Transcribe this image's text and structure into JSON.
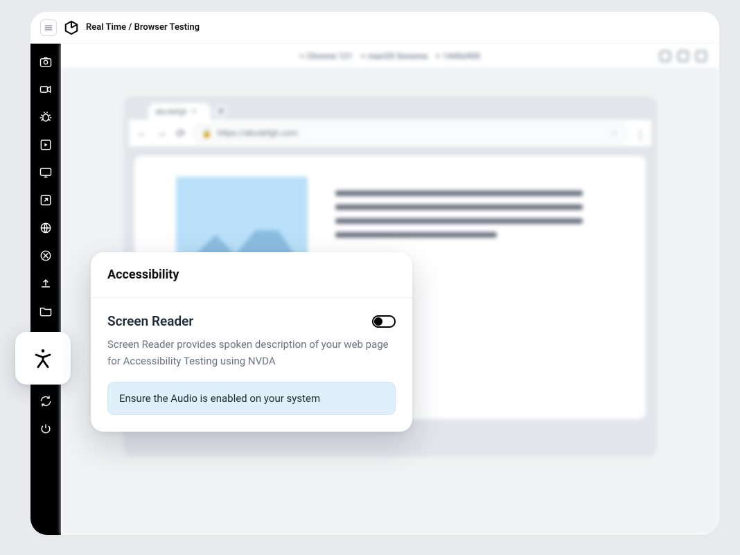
{
  "breadcrumb": "Real Time / Browser Testing",
  "info_pills": {
    "browser": "Chrome 121",
    "os": "macOS Sonoma",
    "resolution": "1440x900"
  },
  "mock_browser": {
    "tab_title": "abcdefgh",
    "url": "https://abcdefgh.com"
  },
  "sidebar_icons": [
    "camera-icon",
    "video-icon",
    "bug-icon",
    "play-square-icon",
    "monitor-icon",
    "external-icon",
    "globe-icon",
    "crop-icon",
    "upload-icon",
    "folder-icon",
    "chrome-icon",
    "refresh-icon",
    "power-icon"
  ],
  "panel": {
    "title": "Accessibility",
    "section_title": "Screen Reader",
    "description": "Screen Reader provides spoken description of your web page for Accessibility Testing using NVDA",
    "note": "Ensure the Audio is enabled on your system",
    "toggle_on": false
  }
}
